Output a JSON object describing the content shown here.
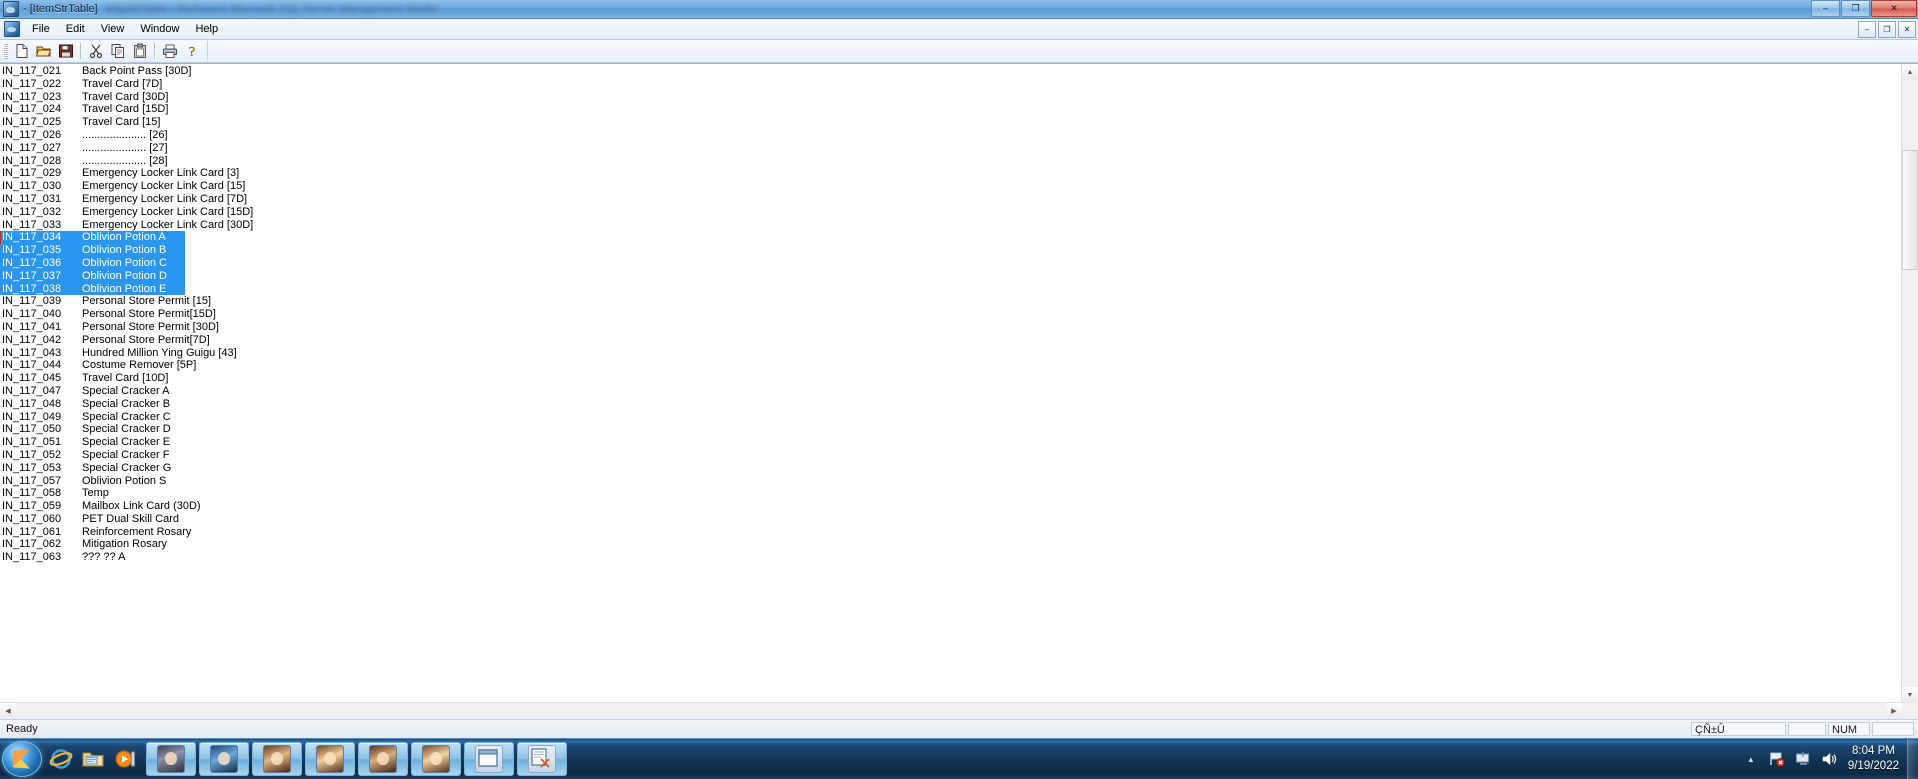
{
  "window": {
    "title": "- [ItemStrTable]",
    "title_blurred": "MapStrTable  -  BluSource   Microsoft SQL Server Management Studio",
    "buttons": {
      "minimize": "–",
      "maximize": "❐",
      "close": "✕"
    }
  },
  "menu": {
    "items": [
      {
        "label": "File"
      },
      {
        "label": "Edit"
      },
      {
        "label": "View"
      },
      {
        "label": "Window"
      },
      {
        "label": "Help"
      }
    ],
    "mdi_buttons": {
      "minimize": "–",
      "restore": "❐",
      "close": "✕"
    }
  },
  "toolbar": {
    "buttons": [
      {
        "name": "new-file-icon",
        "tooltip": "New"
      },
      {
        "name": "open-folder-icon",
        "tooltip": "Open"
      },
      {
        "name": "save-disk-icon",
        "tooltip": "Save"
      },
      {
        "name": "cut-scissors-icon",
        "tooltip": "Cut"
      },
      {
        "name": "copy-icon",
        "tooltip": "Copy"
      },
      {
        "name": "paste-clipboard-icon",
        "tooltip": "Paste"
      },
      {
        "name": "print-icon",
        "tooltip": "Print"
      },
      {
        "name": "about-help-icon",
        "tooltip": "About"
      }
    ]
  },
  "list": {
    "rows": [
      {
        "id": "IN_117_021",
        "name": "Back Point Pass [30D]",
        "selected": false
      },
      {
        "id": "IN_117_022",
        "name": "Travel Card [7D]",
        "selected": false
      },
      {
        "id": "IN_117_023",
        "name": "Travel Card [30D]",
        "selected": false
      },
      {
        "id": "IN_117_024",
        "name": "Travel Card [15D]",
        "selected": false
      },
      {
        "id": "IN_117_025",
        "name": "Travel Card [15]",
        "selected": false
      },
      {
        "id": "IN_117_026",
        "name": "..................... [26]",
        "selected": false
      },
      {
        "id": "IN_117_027",
        "name": "..................... [27]",
        "selected": false
      },
      {
        "id": "IN_117_028",
        "name": "..................... [28]",
        "selected": false
      },
      {
        "id": "IN_117_029",
        "name": "Emergency Locker Link Card [3]",
        "selected": false
      },
      {
        "id": "IN_117_030",
        "name": "Emergency Locker Link Card [15]",
        "selected": false
      },
      {
        "id": "IN_117_031",
        "name": "Emergency Locker Link Card [7D]",
        "selected": false
      },
      {
        "id": "IN_117_032",
        "name": "Emergency Locker Link Card [15D]",
        "selected": false
      },
      {
        "id": "IN_117_033",
        "name": "Emergency Locker Link Card [30D]",
        "selected": false
      },
      {
        "id": "IN_117_034",
        "name": "Oblivion Potion A",
        "selected": true
      },
      {
        "id": "IN_117_035",
        "name": "Oblivion Potion B",
        "selected": true
      },
      {
        "id": "IN_117_036",
        "name": "Oblivion Potion C",
        "selected": true
      },
      {
        "id": "IN_117_037",
        "name": "Oblivion Potion D",
        "selected": true
      },
      {
        "id": "IN_117_038",
        "name": "Oblivion Potion E",
        "selected": true
      },
      {
        "id": "IN_117_039",
        "name": "Personal Store Permit [15]",
        "selected": false
      },
      {
        "id": "IN_117_040",
        "name": "Personal Store Permit[15D]",
        "selected": false
      },
      {
        "id": "IN_117_041",
        "name": "Personal Store Permit [30D]",
        "selected": false
      },
      {
        "id": "IN_117_042",
        "name": "Personal Store Permit[7D]",
        "selected": false
      },
      {
        "id": "IN_117_043",
        "name": "Hundred Million Ying Guigu [43]",
        "selected": false
      },
      {
        "id": "IN_117_044",
        "name": "Costume Remover [5P]",
        "selected": false
      },
      {
        "id": "IN_117_045",
        "name": "Travel Card [10D]",
        "selected": false
      },
      {
        "id": "IN_117_047",
        "name": "Special Cracker A",
        "selected": false
      },
      {
        "id": "IN_117_048",
        "name": "Special Cracker B",
        "selected": false
      },
      {
        "id": "IN_117_049",
        "name": "Special Cracker C",
        "selected": false
      },
      {
        "id": "IN_117_050",
        "name": "Special Cracker D",
        "selected": false
      },
      {
        "id": "IN_117_051",
        "name": "Special Cracker E",
        "selected": false
      },
      {
        "id": "IN_117_052",
        "name": "Special Cracker F",
        "selected": false
      },
      {
        "id": "IN_117_053",
        "name": "Special Cracker G",
        "selected": false
      },
      {
        "id": "IN_117_057",
        "name": "Oblivion Potion S",
        "selected": false
      },
      {
        "id": "IN_117_058",
        "name": "Temp",
        "selected": false
      },
      {
        "id": "IN_117_059",
        "name": "Mailbox Link Card (30D)",
        "selected": false
      },
      {
        "id": "IN_117_060",
        "name": "PET Dual Skill Card",
        "selected": false
      },
      {
        "id": "IN_117_061",
        "name": "Reinforcement Rosary",
        "selected": false
      },
      {
        "id": "IN_117_062",
        "name": "Mitigation Rosary",
        "selected": false
      },
      {
        "id": "IN_117_063",
        "name": "??? ?? A",
        "selected": false
      }
    ]
  },
  "scrollbars": {
    "up_arrow": "▲",
    "down_arrow": "▼",
    "left_arrow": "◀",
    "right_arrow": "▶"
  },
  "status_bar": {
    "message": "Ready",
    "ime": "ÇÑ±Û",
    "caps": "",
    "num": "NUM",
    "scroll": ""
  },
  "taskbar": {
    "start_label": "Start",
    "quick_launch": [
      {
        "name": "internet-explorer-icon"
      },
      {
        "name": "windows-explorer-icon"
      },
      {
        "name": "media-player-icon"
      }
    ],
    "tasks": [
      {
        "name": "game-client-1"
      },
      {
        "name": "game-client-2"
      },
      {
        "name": "game-client-3"
      },
      {
        "name": "game-client-4"
      },
      {
        "name": "game-client-5"
      },
      {
        "name": "game-client-6"
      },
      {
        "name": "editor-window"
      },
      {
        "name": "sql-tool-window"
      }
    ],
    "tray": {
      "show_hidden": "▲",
      "network_flag": "network-flag-icon",
      "action_center": "action-center-icon",
      "volume": "volume-icon"
    },
    "clock": {
      "time": "8:04 PM",
      "date": "9/19/2022"
    }
  },
  "colors": {
    "selection": "#2a96f0",
    "selection_text": "#ffffff",
    "window_bg": "#ffffff",
    "taskbar": "#113454"
  }
}
